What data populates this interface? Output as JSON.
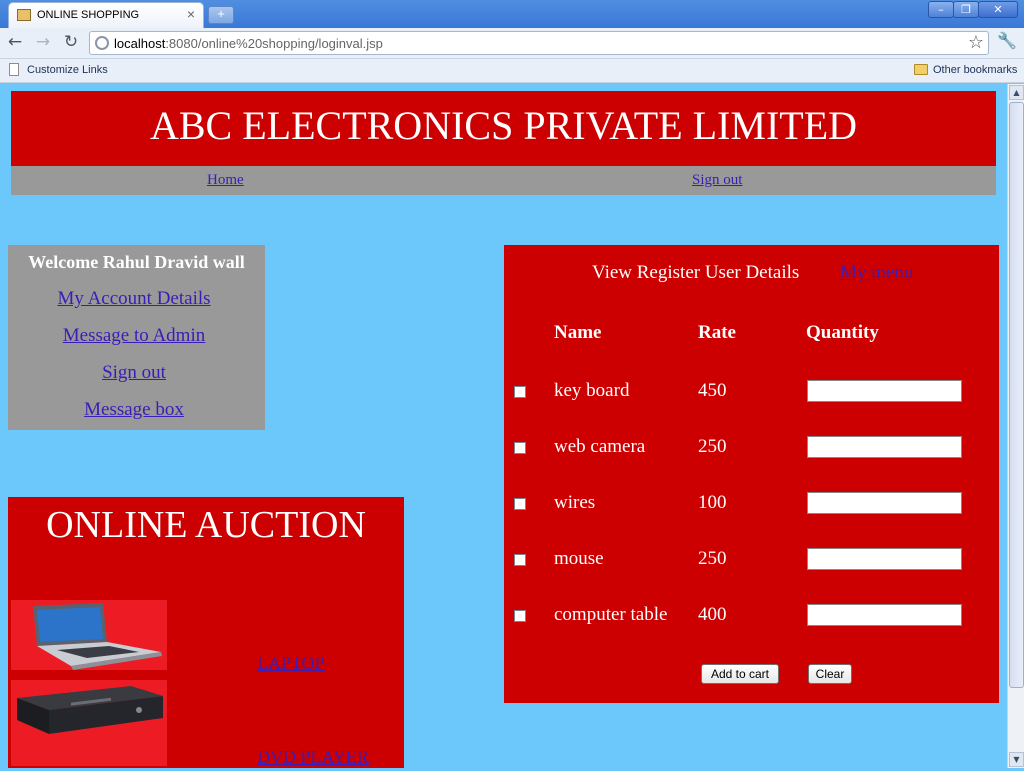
{
  "browser": {
    "tab_title": "ONLINE SHOPPING",
    "tab_close": "×",
    "new_tab": "+",
    "url_host": "localhost",
    "url_path": ":8080/online%20shopping/loginval.jsp",
    "bookmark_customize": "Customize Links",
    "bookmark_other": "Other bookmarks"
  },
  "header": {
    "company": "ABC ELECTRONICS PRIVATE LIMITED",
    "nav": {
      "home": "Home",
      "signout": "Sign out"
    }
  },
  "sidebar": {
    "welcome": "Welcome Rahul Dravid wall",
    "links": [
      "My Account Details",
      "Message to Admin",
      "Sign out",
      "Message box"
    ]
  },
  "auction": {
    "title": "ONLINE AUCTION",
    "items": [
      "LAPTOP",
      "DVD PLAYER"
    ]
  },
  "products": {
    "heading": "View Register User Details",
    "my_menu": "My menu",
    "columns": {
      "name": "Name",
      "rate": "Rate",
      "quantity": "Quantity"
    },
    "rows": [
      {
        "name": "key board",
        "rate": "450",
        "checked": false,
        "qty": ""
      },
      {
        "name": "web camera",
        "rate": "250",
        "checked": false,
        "qty": ""
      },
      {
        "name": "wires",
        "rate": "100",
        "checked": false,
        "qty": ""
      },
      {
        "name": "mouse",
        "rate": "250",
        "checked": false,
        "qty": ""
      },
      {
        "name": "computer table",
        "rate": "400",
        "checked": false,
        "qty": ""
      }
    ],
    "add_to_cart": "Add to cart",
    "clear": "Clear"
  },
  "colors": {
    "page_bg": "#6cc8fb",
    "banner_red": "#cc0000",
    "nav_gray": "#999999",
    "link_purple": "#3b1db6",
    "image_bg_red": "#ed1c24"
  },
  "icons": [
    "back-arrow-icon",
    "forward-arrow-icon",
    "reload-icon",
    "page-icon",
    "star-icon",
    "wrench-icon",
    "folder-icon"
  ]
}
